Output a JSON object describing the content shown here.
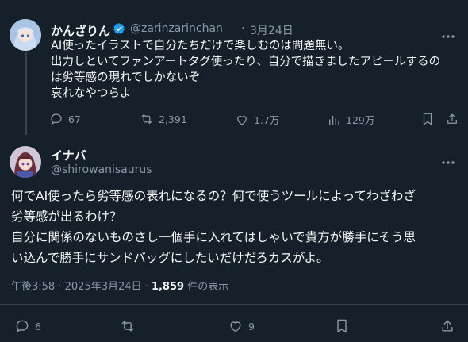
{
  "tweet1": {
    "display_name": "かんざりん",
    "handle": "@zarinzarinchan",
    "separator": "·",
    "date": "3月24日",
    "lines": [
      "AI使ったイラストで自分たちだけで楽しむのは問題無い。",
      "出力しといてファンアートタグ使ったり、自分で描きましたアピールするの",
      "は劣等感の現れでしかないぞ",
      "哀れなやつらよ"
    ],
    "replies": "67",
    "reposts": "2,391",
    "likes": "1.7万",
    "views": "129万"
  },
  "tweet2": {
    "display_name": "イナバ",
    "handle": "@shirowanisaurus",
    "lines": [
      "何でAI使ったら劣等感の表れになるの？何で使うツールによってわざわざ",
      "劣等感が出るわけ？",
      "自分に関係のないものさし一個手に入れてはしゃいで貴方が勝手にそう思",
      "い込んで勝手にサンドバッグにしたいだけだろカスがよ。"
    ],
    "time": "午後3:58",
    "date": "2025年3月24日",
    "separator": "·",
    "views_count": "1,859",
    "views_label": "件の表示",
    "replies": "6",
    "likes": "9"
  },
  "colors": {
    "background": "#15202b",
    "text": "#f7f9f9",
    "muted": "#8b98a5",
    "verified": "#1d9bf0",
    "divider": "#38444d"
  }
}
